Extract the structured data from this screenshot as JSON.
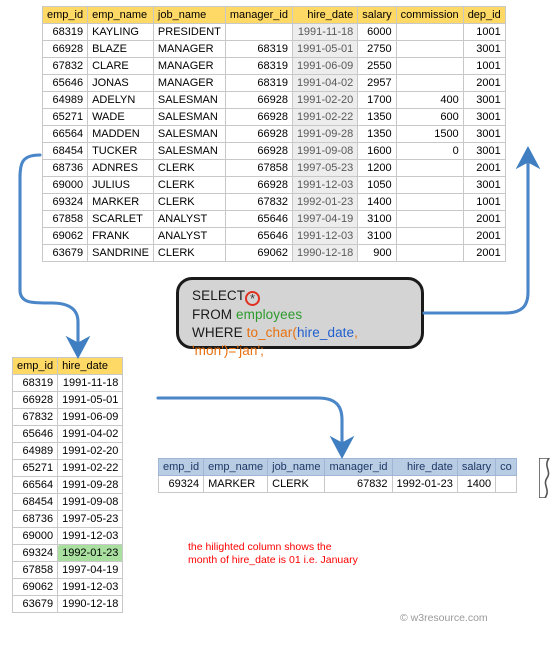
{
  "employees_table": {
    "name": "employees",
    "columns": [
      "emp_id",
      "emp_name",
      "job_name",
      "manager_id",
      "hire_date",
      "salary",
      "commission",
      "dep_id"
    ],
    "rows": [
      [
        "68319",
        "KAYLING",
        "PRESIDENT",
        "",
        "1991-11-18",
        "6000",
        "",
        "1001"
      ],
      [
        "66928",
        "BLAZE",
        "MANAGER",
        "68319",
        "1991-05-01",
        "2750",
        "",
        "3001"
      ],
      [
        "67832",
        "CLARE",
        "MANAGER",
        "68319",
        "1991-06-09",
        "2550",
        "",
        "1001"
      ],
      [
        "65646",
        "JONAS",
        "MANAGER",
        "68319",
        "1991-04-02",
        "2957",
        "",
        "2001"
      ],
      [
        "64989",
        "ADELYN",
        "SALESMAN",
        "66928",
        "1991-02-20",
        "1700",
        "400",
        "3001"
      ],
      [
        "65271",
        "WADE",
        "SALESMAN",
        "66928",
        "1991-02-22",
        "1350",
        "600",
        "3001"
      ],
      [
        "66564",
        "MADDEN",
        "SALESMAN",
        "66928",
        "1991-09-28",
        "1350",
        "1500",
        "3001"
      ],
      [
        "68454",
        "TUCKER",
        "SALESMAN",
        "66928",
        "1991-09-08",
        "1600",
        "0",
        "3001"
      ],
      [
        "68736",
        "ADNRES",
        "CLERK",
        "67858",
        "1997-05-23",
        "1200",
        "",
        "2001"
      ],
      [
        "69000",
        "JULIUS",
        "CLERK",
        "66928",
        "1991-12-03",
        "1050",
        "",
        "3001"
      ],
      [
        "69324",
        "MARKER",
        "CLERK",
        "67832",
        "1992-01-23",
        "1400",
        "",
        "1001"
      ],
      [
        "67858",
        "SCARLET",
        "ANALYST",
        "65646",
        "1997-04-19",
        "3100",
        "",
        "2001"
      ],
      [
        "69062",
        "FRANK",
        "ANALYST",
        "65646",
        "1991-12-03",
        "3100",
        "",
        "2001"
      ],
      [
        "63679",
        "SANDRINE",
        "CLERK",
        "69062",
        "1990-12-18",
        "900",
        "",
        "2001"
      ]
    ]
  },
  "sql": {
    "select_keyword": "SELECT",
    "star": "*",
    "from_keyword": "FROM",
    "from_table": "employees",
    "where_keyword": "WHERE",
    "where_function": "to_char(",
    "where_column": "hire_date",
    "where_rest": ", 'mon')='jan';"
  },
  "result_left_table": {
    "columns": [
      "emp_id",
      "hire_date"
    ],
    "highlight_value": "1992-01-23",
    "rows": [
      [
        "68319",
        "1991-11-18"
      ],
      [
        "66928",
        "1991-05-01"
      ],
      [
        "67832",
        "1991-06-09"
      ],
      [
        "65646",
        "1991-04-02"
      ],
      [
        "64989",
        "1991-02-20"
      ],
      [
        "65271",
        "1991-02-22"
      ],
      [
        "66564",
        "1991-09-28"
      ],
      [
        "68454",
        "1991-09-08"
      ],
      [
        "68736",
        "1997-05-23"
      ],
      [
        "69000",
        "1991-12-03"
      ],
      [
        "69324",
        "1992-01-23"
      ],
      [
        "67858",
        "1997-04-19"
      ],
      [
        "69062",
        "1991-12-03"
      ],
      [
        "63679",
        "1990-12-18"
      ]
    ]
  },
  "result_blue_table": {
    "columns": [
      "emp_id",
      "emp_name",
      "job_name",
      "manager_id",
      "hire_date",
      "salary",
      "co"
    ],
    "rows": [
      [
        "69324",
        "MARKER",
        "CLERK",
        "67832",
        "1992-01-23",
        "1400",
        ""
      ]
    ]
  },
  "annotation": {
    "line1": "the hilighted column shows the",
    "line2": "month of hire_date is 01 i.e. January"
  },
  "watermark": {
    "text": "© w3resource.com"
  },
  "colors": {
    "header_yellow": "#ffd966",
    "header_blue": "#b8cce4",
    "highlight_green": "#a9e0a0",
    "annotation_red": "#ff0000",
    "arrow_blue": "#4a86c8",
    "sql_bg": "#d4d4d4",
    "sql_table_green": "#2c9b2c",
    "sql_function_orange": "#e8700f",
    "sql_column_blue": "#1f5fd0"
  }
}
